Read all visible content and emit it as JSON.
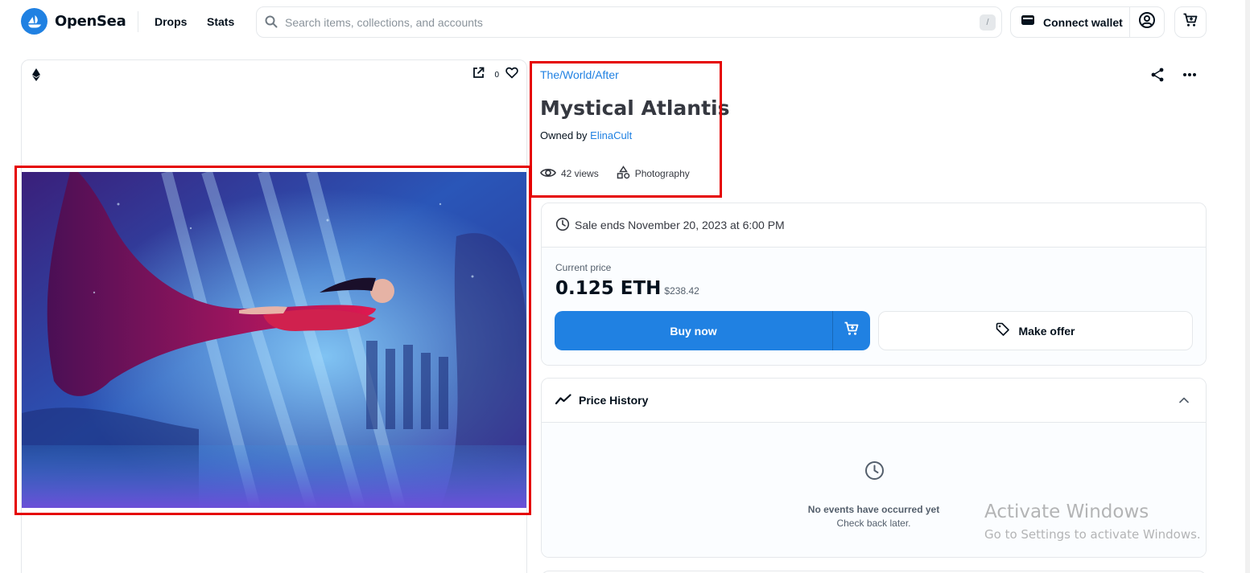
{
  "header": {
    "brand": "OpenSea",
    "nav": [
      "Drops",
      "Stats"
    ],
    "search_placeholder": "Search items, collections, and accounts",
    "search_shortcut": "/",
    "connect_wallet": "Connect wallet"
  },
  "media": {
    "favorites_count": "0",
    "image_alt": "Mystical Atlantis"
  },
  "item": {
    "collection": "The/World/After",
    "title": "Mystical Atlantis",
    "owned_by_prefix": "Owned by ",
    "owner": "ElinaCult",
    "views": "42 views",
    "category": "Photography"
  },
  "sale": {
    "ends": "Sale ends November 20, 2023 at 6:00 PM",
    "current_price_label": "Current price",
    "price": "0.125 ETH",
    "price_usd": "$238.42",
    "buy_now": "Buy now",
    "make_offer": "Make offer"
  },
  "price_history": {
    "title": "Price History",
    "empty_title": "No events have occurred yet",
    "empty_sub": "Check back later."
  },
  "watermark": {
    "title": "Activate Windows",
    "sub": "Go to Settings to activate Windows."
  },
  "colors": {
    "accent": "#2081e2",
    "highlight": "#e50000",
    "text": "#04111d",
    "border": "#e5e8eb"
  }
}
